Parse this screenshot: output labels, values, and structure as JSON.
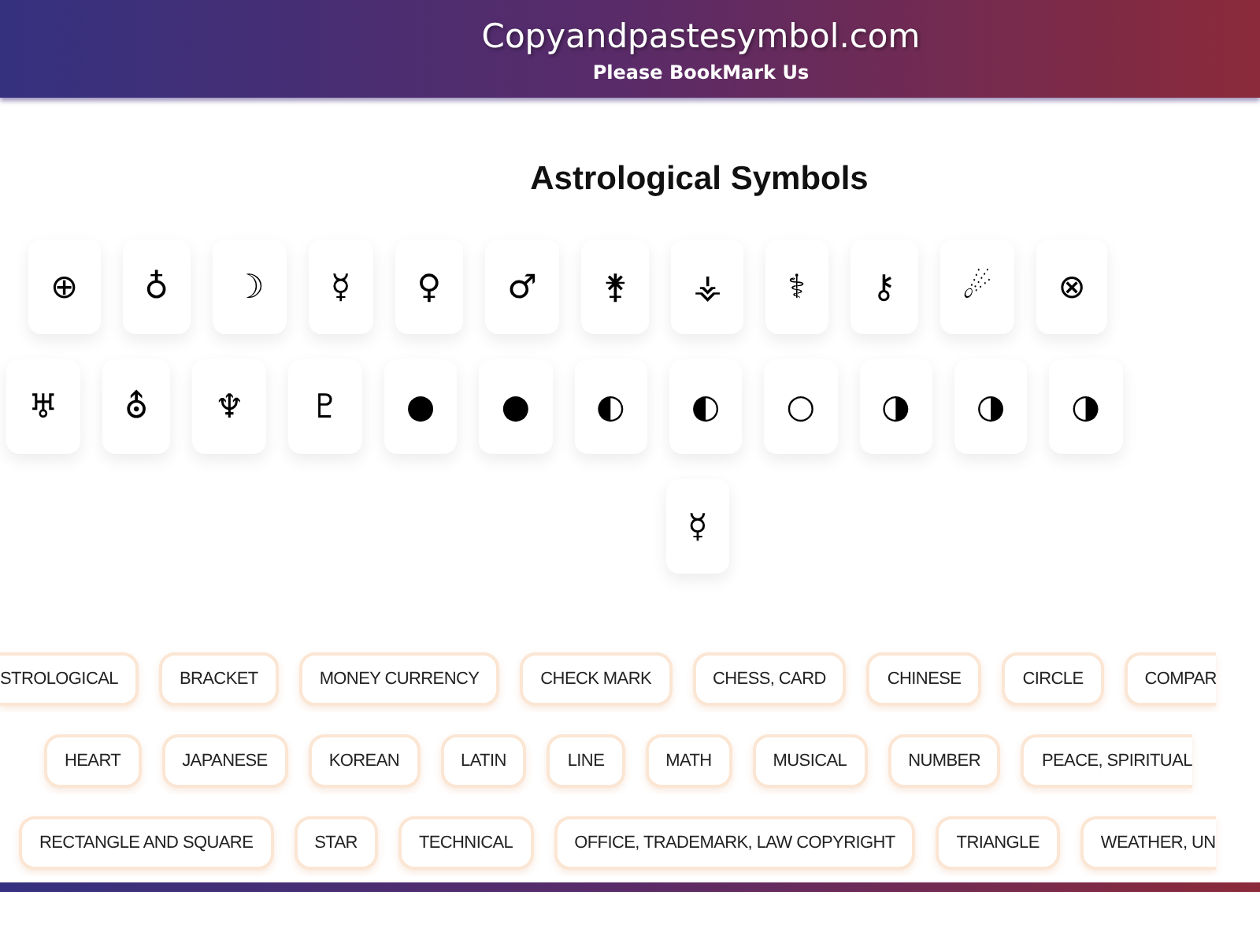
{
  "header": {
    "title": "Copyandpastesymbol.com",
    "subtitle": "Please BookMark Us"
  },
  "page_title": "Astrological Symbols",
  "symbol_rows": [
    [
      "⊕",
      "♁",
      "☽",
      "☿",
      "♀",
      "♂",
      "⚵",
      "⚶",
      "⚕",
      "⚷",
      "☄",
      "⊗"
    ],
    [
      "♅",
      "⛢",
      "♆",
      "♇",
      "●",
      "●",
      "◐",
      "◐",
      "○",
      "◑",
      "◑",
      "◑"
    ],
    [
      "☿"
    ]
  ],
  "tag_rows": [
    [
      "STROLOGICAL",
      "BRACKET",
      "MONEY CURRENCY",
      "CHECK MARK",
      "CHESS, CARD",
      "CHINESE",
      "CIRCLE",
      "COMPAR"
    ],
    [
      "HEART",
      "JAPANESE",
      "KOREAN",
      "LATIN",
      "LINE",
      "MATH",
      "MUSICAL",
      "NUMBER",
      "PEACE, SPIRITUAL"
    ],
    [
      "RECTANGLE AND SQUARE",
      "STAR",
      "TECHNICAL",
      "OFFICE, TRADEMARK, LAW COPYRIGHT",
      "TRIANGLE",
      "WEATHER, UN"
    ]
  ]
}
